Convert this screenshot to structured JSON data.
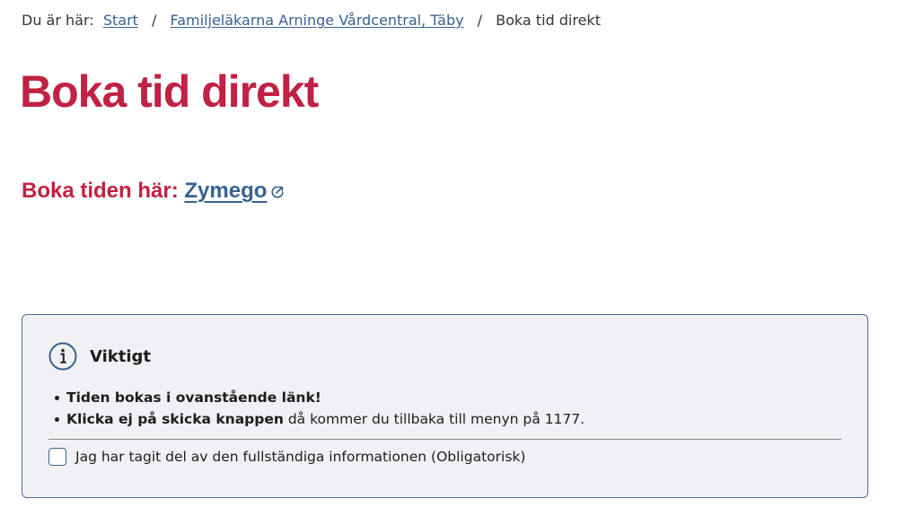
{
  "breadcrumb": {
    "prefix": "Du är här:",
    "items": [
      {
        "label": "Start"
      },
      {
        "label": "Familjeläkarna Arninge Vårdcentral, Täby"
      },
      {
        "label": "Boka tid direkt"
      }
    ],
    "separator": "/"
  },
  "page_title": "Boka tid direkt",
  "booking": {
    "prefix": "Boka tiden här:",
    "link_label": "Zymego",
    "link_icon": "external-link-icon"
  },
  "info_box": {
    "icon": "info-icon",
    "title": "Viktigt",
    "items": [
      {
        "bold": "Tiden bokas i ovanstående länk!",
        "rest": ""
      },
      {
        "bold": "Klicka ej på skicka knappen",
        "rest": " då kommer du tillbaka till menyn på 1177."
      }
    ],
    "checkbox_label": "Jag har tagit del av den fullständiga informationen (Obligatorisk)",
    "checkbox_checked": false
  },
  "colors": {
    "title_red": "#c12143",
    "link_blue": "#396291",
    "box_bg": "#f1f1f5",
    "box_border": "#4b6e96"
  }
}
